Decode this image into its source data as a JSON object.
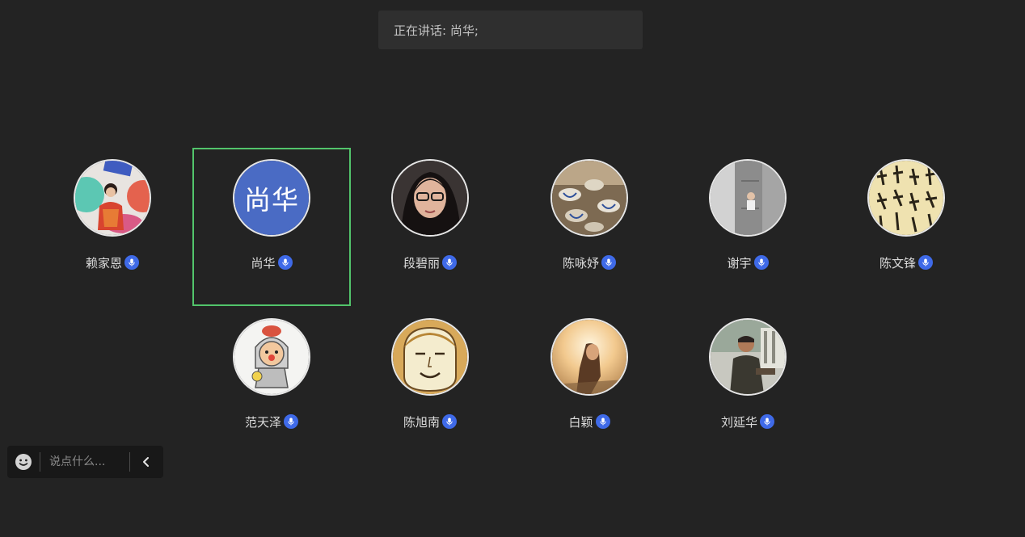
{
  "speaking": {
    "text": "正在讲话: 尚华;"
  },
  "participants": [
    {
      "name": "赖家恩",
      "avatar": "photo-woman-colorful-wall",
      "mic_icon": "microphone-icon",
      "active": false
    },
    {
      "name": "尚华",
      "avatar_text": "尚华",
      "avatar_color": "#4a6bc4",
      "mic_icon": "microphone-icon",
      "active": true
    },
    {
      "name": "段碧丽",
      "avatar": "photo-woman-glasses",
      "mic_icon": "microphone-icon",
      "active": false
    },
    {
      "name": "陈咏妤",
      "avatar": "photo-ceramic-cups",
      "mic_icon": "microphone-icon",
      "active": false
    },
    {
      "name": "谢宇",
      "avatar": "photo-person-doorway",
      "mic_icon": "microphone-icon",
      "active": false
    },
    {
      "name": "陈文锋",
      "avatar": "photo-calligraphy",
      "mic_icon": "microphone-icon",
      "active": false
    },
    {
      "name": "范天泽",
      "avatar": "cartoon-clown-knight",
      "mic_icon": "microphone-icon",
      "active": false
    },
    {
      "name": "陈旭南",
      "avatar": "cartoon-smiling-face",
      "mic_icon": "microphone-icon",
      "active": false
    },
    {
      "name": "白颖",
      "avatar": "photo-woman-sunset",
      "mic_icon": "microphone-icon",
      "active": false
    },
    {
      "name": "刘延华",
      "avatar": "photo-man-sitting",
      "mic_icon": "microphone-icon",
      "active": false
    }
  ],
  "chat": {
    "placeholder": "说点什么...",
    "emoji_icon": "smiley-icon",
    "collapse_icon": "chevron-left-icon"
  },
  "colors": {
    "background": "#232323",
    "active_border": "#52c46b",
    "mic_badge": "#3f6ae8"
  }
}
